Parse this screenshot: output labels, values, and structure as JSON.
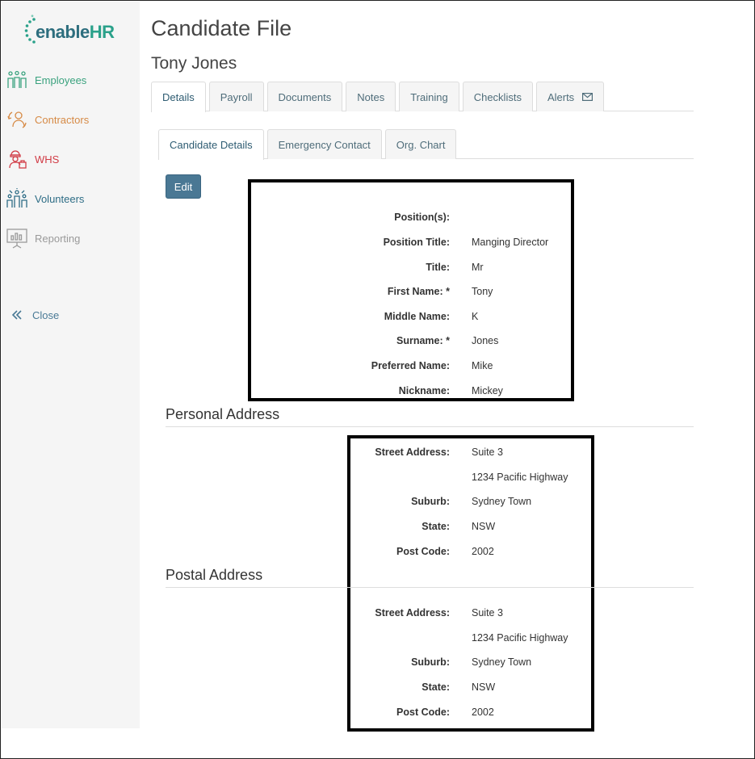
{
  "app": {
    "logo_enable": "enable",
    "logo_hr": "HR"
  },
  "sidebar": {
    "items": [
      {
        "label": "Employees",
        "icon": "employees-icon",
        "color": "#3aa27e"
      },
      {
        "label": "Contractors",
        "icon": "contractors-icon",
        "color": "#d68a45"
      },
      {
        "label": "WHS",
        "icon": "whs-icon",
        "color": "#d13c46"
      },
      {
        "label": "Volunteers",
        "icon": "volunteers-icon",
        "color": "#2e6d86"
      },
      {
        "label": "Reporting",
        "icon": "reporting-icon",
        "color": "#9a9a9a"
      }
    ],
    "close_label": "Close"
  },
  "header": {
    "title": "Candidate File",
    "person_name": "Tony Jones"
  },
  "main_tabs": [
    {
      "label": "Details",
      "active": true
    },
    {
      "label": "Payroll"
    },
    {
      "label": "Documents"
    },
    {
      "label": "Notes"
    },
    {
      "label": "Training"
    },
    {
      "label": "Checklists"
    },
    {
      "label": "Alerts"
    }
  ],
  "sub_tabs": [
    {
      "label": "Candidate Details",
      "active": true
    },
    {
      "label": "Emergency Contact"
    },
    {
      "label": "Org. Chart"
    }
  ],
  "edit_label": "Edit",
  "details": [
    {
      "label": "Position(s):",
      "value": ""
    },
    {
      "label": "Position Title:",
      "value": "Manging Director"
    },
    {
      "label": "Title:",
      "value": "Mr"
    },
    {
      "label": "First Name: *",
      "value": "Tony"
    },
    {
      "label": "Middle Name:",
      "value": "K"
    },
    {
      "label": "Surname: *",
      "value": "Jones"
    },
    {
      "label": "Preferred Name:",
      "value": "Mike"
    },
    {
      "label": "Nickname:",
      "value": "Mickey"
    }
  ],
  "personal_address": {
    "title": "Personal Address",
    "street_label": "Street Address:",
    "street_line1": "Suite 3",
    "street_line2": "1234 Pacific Highway",
    "suburb_label": "Suburb:",
    "suburb": "Sydney Town",
    "state_label": "State:",
    "state": "NSW",
    "postcode_label": "Post Code:",
    "postcode": "2002"
  },
  "postal_address": {
    "title": "Postal Address",
    "street_label": "Street Address:",
    "street_line1": "Suite 3",
    "street_line2": "1234 Pacific Highway",
    "suburb_label": "Suburb:",
    "suburb": "Sydney Town",
    "state_label": "State:",
    "state": "NSW",
    "postcode_label": "Post Code:",
    "postcode": "2002"
  }
}
